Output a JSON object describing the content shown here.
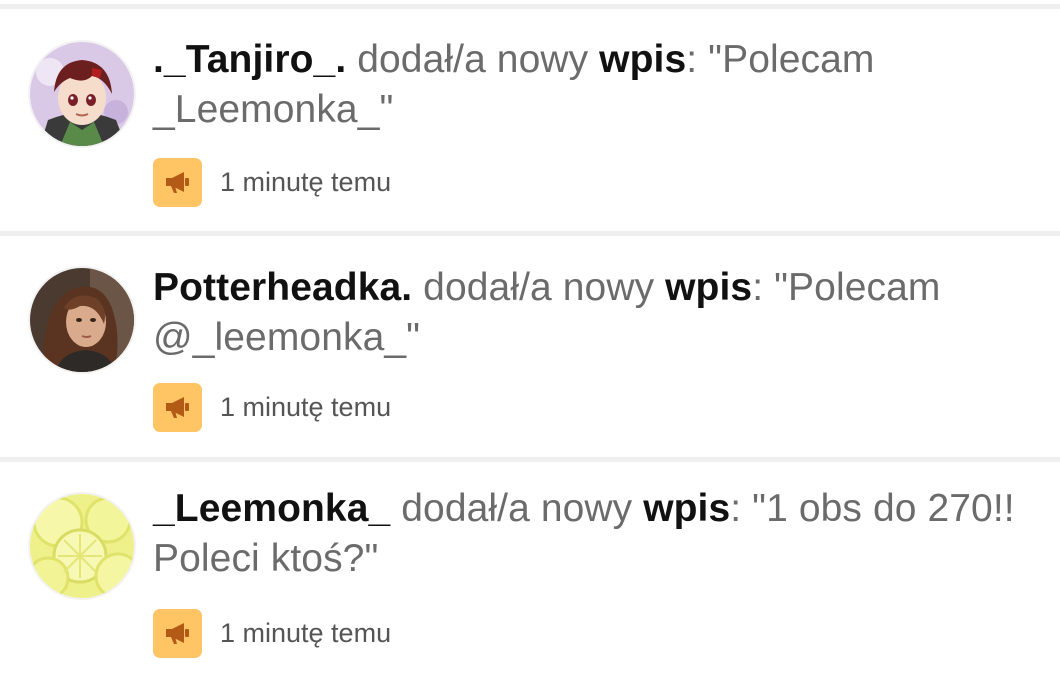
{
  "activity": {
    "items": [
      {
        "username": "._Tanjiro_.",
        "action_text": "dodał/a nowy",
        "object_label": "wpis",
        "separator": ":",
        "quote": "\"Polecam _Leemonka_\"",
        "time": "1 minutę temu",
        "badge_icon": "megaphone-icon",
        "avatar_icon": "anime-boy-avatar"
      },
      {
        "username": "Potterheadka.",
        "action_text": "dodał/a nowy",
        "object_label": "wpis",
        "separator": ":",
        "quote": "\"Polecam @_leemonka_\"",
        "time": "1 minutę temu",
        "badge_icon": "megaphone-icon",
        "avatar_icon": "portrait-photo-avatar"
      },
      {
        "username": "_Leemonka_",
        "action_text": "dodał/a nowy",
        "object_label": "wpis",
        "separator": ":",
        "quote": "\"1 obs do 270!! Poleci ktoś?\"",
        "time": "1 minutę temu",
        "badge_icon": "megaphone-icon",
        "avatar_icon": "lemon-slices-avatar"
      }
    ]
  },
  "colors": {
    "badge": "#ffc463",
    "badge_icon": "#b35a16",
    "divider": "#efefef",
    "username": "#111111",
    "muted_text": "#6b6b6b",
    "time": "#555555"
  }
}
